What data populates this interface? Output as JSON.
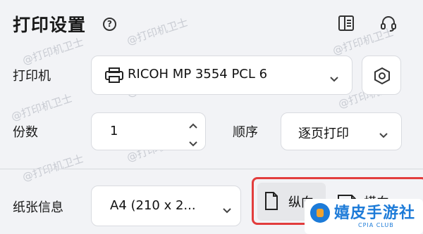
{
  "header": {
    "title": "打印设置",
    "help_glyph": "?"
  },
  "watermark": "@打印机卫士",
  "printer": {
    "label": "打印机",
    "selected": "RICOH MP 3554 PCL 6"
  },
  "copies": {
    "label": "份数",
    "value": "1"
  },
  "order": {
    "label": "顺序",
    "selected": "逐页打印"
  },
  "paper": {
    "label": "纸张信息",
    "selected": "A4 (210 x 2..."
  },
  "orientation": {
    "portrait_label": "纵向",
    "landscape_label": "横向"
  },
  "brand": {
    "name": "嬉皮手游社",
    "sub": "CPIA CLUB"
  },
  "colors": {
    "background": "#f2f3f6",
    "highlight_border": "#e23d3d",
    "brand_blue": "#1d7bd8"
  }
}
